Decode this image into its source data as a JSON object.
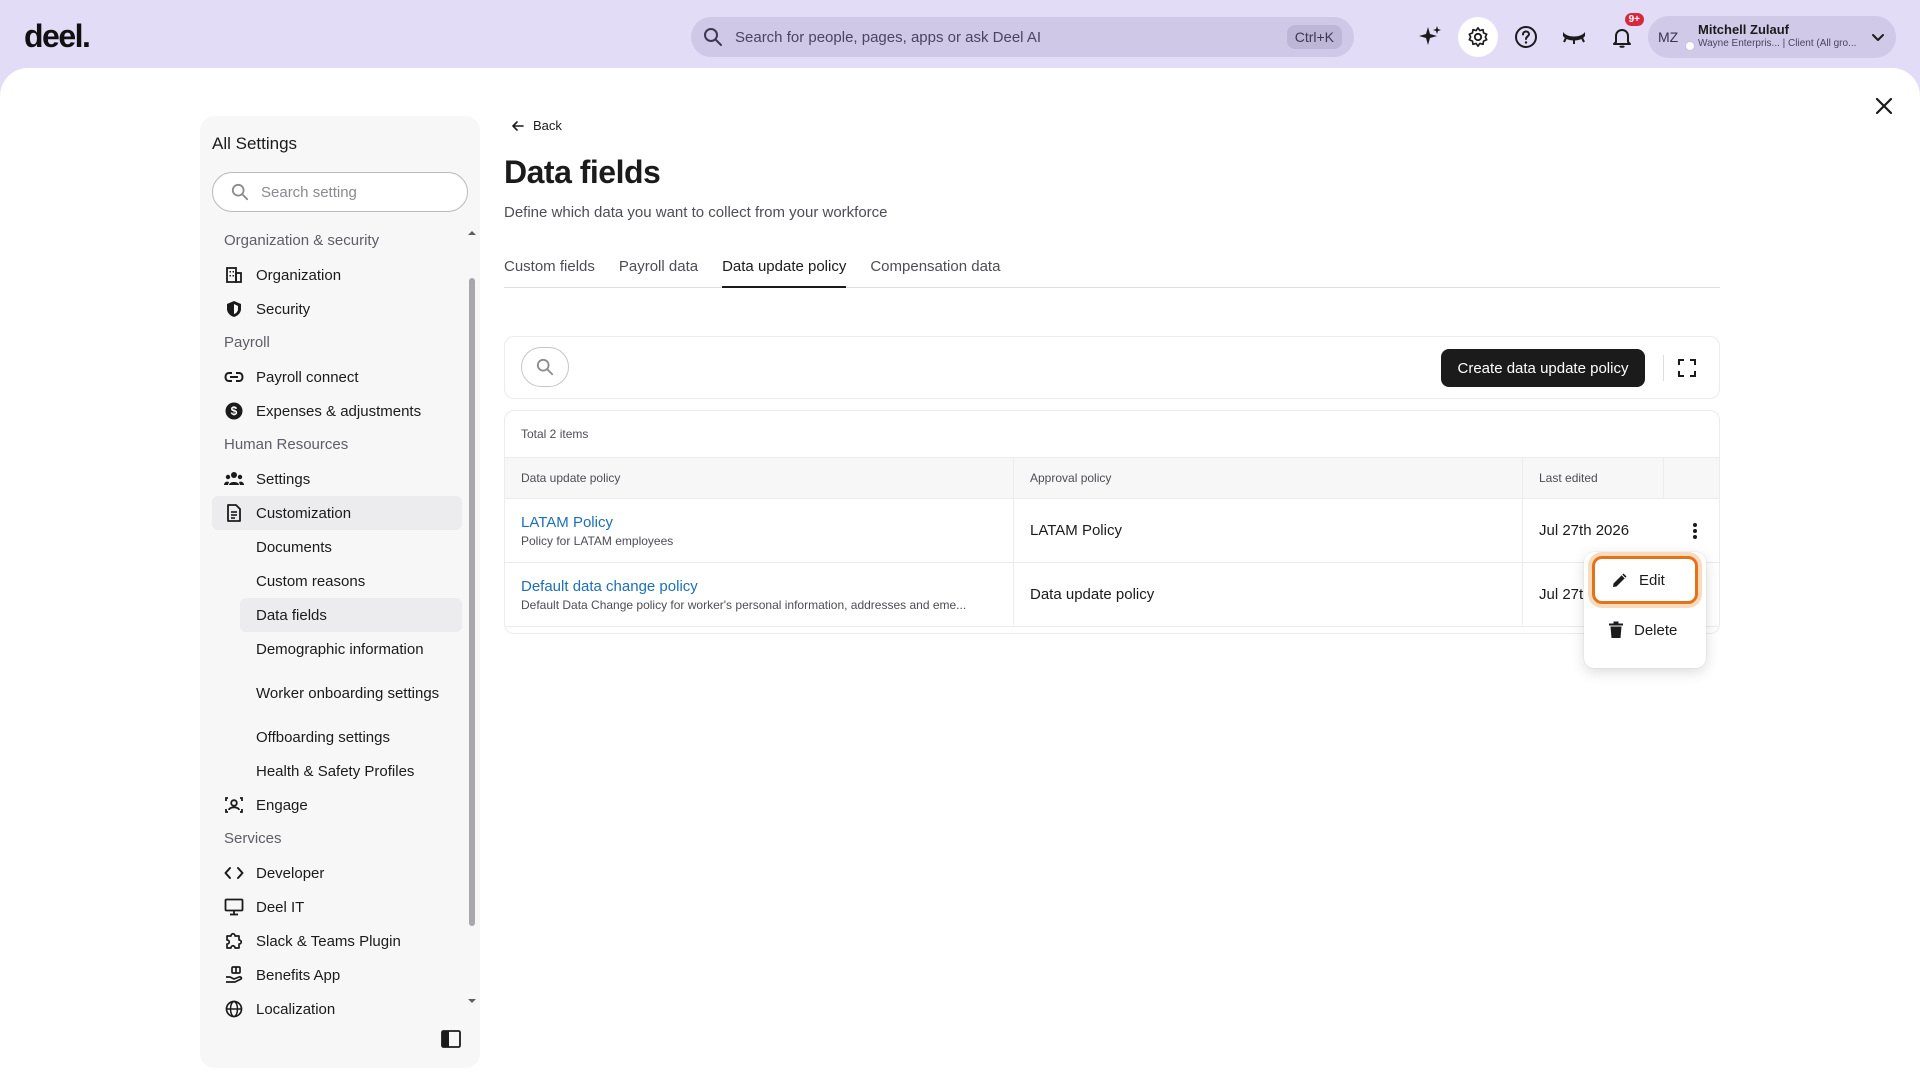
{
  "header": {
    "logo": "deel.",
    "search_placeholder": "Search for people, pages, apps or ask Deel AI",
    "search_shortcut": "Ctrl+K",
    "notification_count": "9+",
    "user": {
      "initials": "MZ",
      "name": "Mitchell Zulauf",
      "org": "Wayne Enterpris... | Client (All gro..."
    }
  },
  "sidebar": {
    "title": "All Settings",
    "search_placeholder": "Search setting",
    "sections": [
      {
        "label": "Organization & security"
      },
      {
        "label": "Payroll"
      },
      {
        "label": "Human Resources"
      },
      {
        "label": "Services"
      }
    ],
    "items": {
      "organization": "Organization",
      "security": "Security",
      "payroll_connect": "Payroll connect",
      "expenses": "Expenses & adjustments",
      "settings": "Settings",
      "customization": "Customization",
      "documents": "Documents",
      "custom_reasons": "Custom reasons",
      "data_fields": "Data fields",
      "demographic": "Demographic information",
      "worker_onboarding": "Worker onboarding settings",
      "offboarding": "Offboarding settings",
      "health_safety": "Health & Safety Profiles",
      "engage": "Engage",
      "developer": "Developer",
      "deel_it": "Deel IT",
      "slack_teams": "Slack & Teams Plugin",
      "benefits_app": "Benefits App",
      "localization": "Localization"
    }
  },
  "page": {
    "back_label": "Back",
    "title": "Data fields",
    "subtitle": "Define which data you want to collect from your workforce",
    "tabs": [
      "Custom fields",
      "Payroll data",
      "Data update policy",
      "Compensation data"
    ],
    "active_tab": "Data update policy"
  },
  "toolbar": {
    "create_label": "Create data update policy"
  },
  "table": {
    "total_label": "Total 2 items",
    "columns": [
      "Data update policy",
      "Approval policy",
      "Last edited"
    ],
    "rows": [
      {
        "name": "LATAM Policy",
        "description": "Policy for LATAM employees",
        "approval": "LATAM Policy",
        "last_edited": "Jul 27th 2026"
      },
      {
        "name": "Default data change policy",
        "description": "Default Data Change policy for worker's personal information, addresses and eme...",
        "approval": "Data update policy",
        "last_edited": "Jul 27t"
      }
    ]
  },
  "menu": {
    "edit": "Edit",
    "delete": "Delete"
  },
  "colors": {
    "header_bg": "#e2dcf6",
    "primary_button": "#1b1b1b",
    "link": "#1d6fb8",
    "focus_ring": "#e2731b",
    "badge": "#d6293c"
  }
}
